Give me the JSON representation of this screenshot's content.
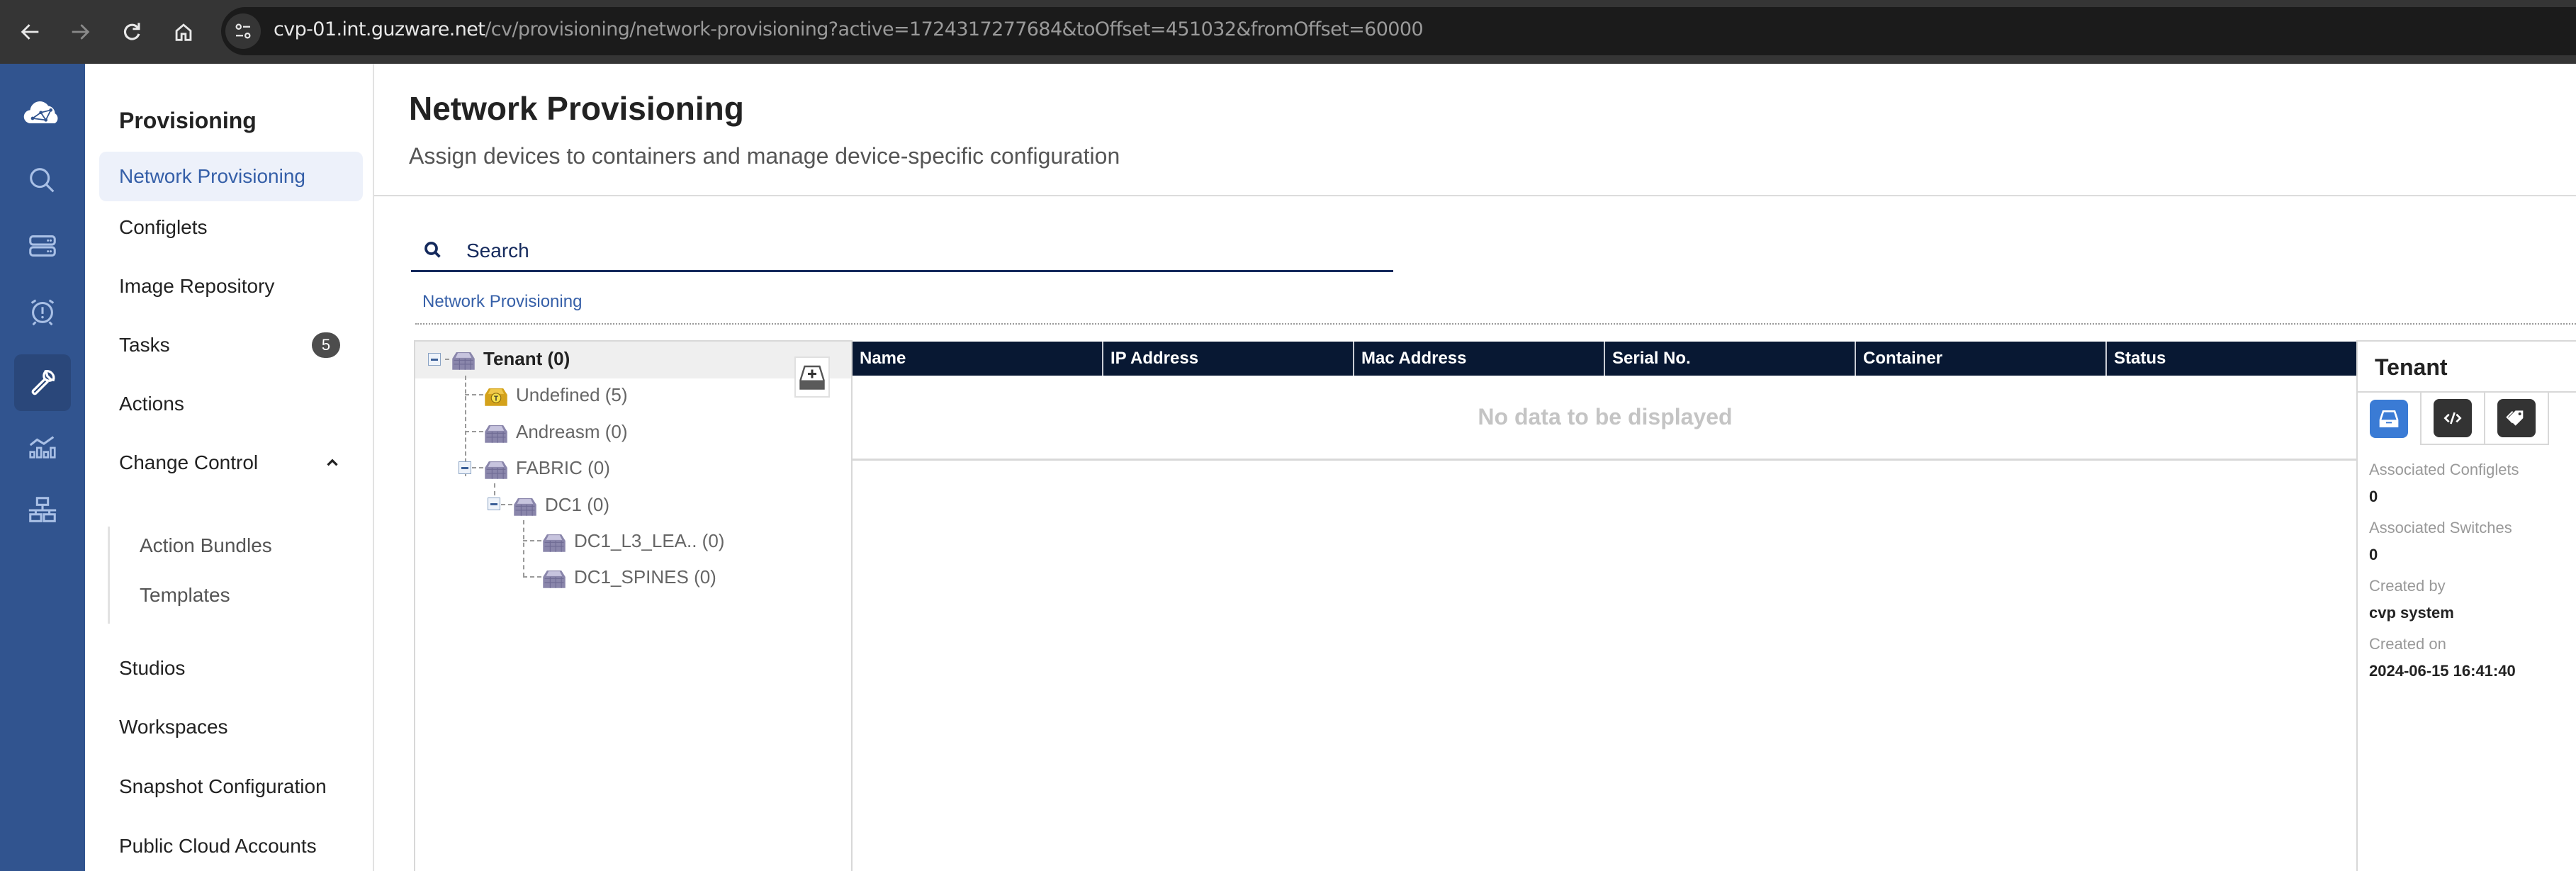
{
  "browser": {
    "url_host": "cvp-01.int.guzware.net",
    "url_path": "/cv/provisioning/network-provisioning?active=1724317277684&toOffset=451032&fromOffset=60000",
    "buttons": [
      "back",
      "forward",
      "reload",
      "home"
    ]
  },
  "rail": {
    "logo": "cloudvision-logo-icon",
    "items": [
      {
        "icon": "search-icon",
        "active": false
      },
      {
        "icon": "devices-icon",
        "active": false
      },
      {
        "icon": "events-alarm-icon",
        "active": false
      },
      {
        "icon": "provisioning-wrench-icon",
        "active": true
      },
      {
        "icon": "dashboards-chart-icon",
        "active": false
      },
      {
        "icon": "topology-icon",
        "active": false
      }
    ]
  },
  "sidebar": {
    "title": "Provisioning",
    "items": [
      {
        "label": "Network Provisioning",
        "active": true
      },
      {
        "label": "Configlets"
      },
      {
        "label": "Image Repository"
      },
      {
        "label": "Tasks",
        "badge": "5"
      },
      {
        "label": "Actions"
      },
      {
        "label": "Change Control",
        "expanded": true
      }
    ],
    "change_control_children": [
      {
        "label": "Action Bundles"
      },
      {
        "label": "Templates"
      }
    ],
    "items_after": [
      {
        "label": "Studios"
      },
      {
        "label": "Workspaces"
      },
      {
        "label": "Snapshot Configuration"
      },
      {
        "label": "Public Cloud Accounts"
      }
    ]
  },
  "header": {
    "title": "Network Provisioning",
    "subtitle": "Assign devices to containers and manage device-specific configuration"
  },
  "search": {
    "placeholder": "Search",
    "value": ""
  },
  "breadcrumb": [
    "Network Provisioning"
  ],
  "tree": {
    "nodes": [
      {
        "label": "Tenant (0)",
        "level": 0,
        "expanded": true,
        "selected": true,
        "type": "container"
      },
      {
        "label": "Undefined (5)",
        "level": 1,
        "type": "undefined-container"
      },
      {
        "label": "Andreasm (0)",
        "level": 1,
        "type": "container"
      },
      {
        "label": "FABRIC (0)",
        "level": 1,
        "expanded": true,
        "type": "container"
      },
      {
        "label": "DC1 (0)",
        "level": 2,
        "expanded": true,
        "type": "container"
      },
      {
        "label": "DC1_L3_LEA.. (0)",
        "level": 3,
        "type": "container"
      },
      {
        "label": "DC1_SPINES (0)",
        "level": 3,
        "type": "container"
      }
    ],
    "add_button": "add-container"
  },
  "table": {
    "columns": [
      "Name",
      "IP Address",
      "Mac Address",
      "Serial No.",
      "Container",
      "Status"
    ],
    "rows": [],
    "empty_text": "No data to be displayed"
  },
  "info_panel": {
    "title": "Tenant",
    "tabs": [
      {
        "icon": "container-info-icon",
        "active": true
      },
      {
        "icon": "code-configlet-icon",
        "active": false
      },
      {
        "icon": "tag-icon",
        "active": false
      }
    ],
    "fields": [
      {
        "label": "Associated Configlets",
        "value": "0"
      },
      {
        "label": "Associated Switches",
        "value": "0"
      },
      {
        "label": "Created by",
        "value": "cvp system"
      },
      {
        "label": "Created on",
        "value": "2024-06-15 16:41:40"
      }
    ]
  },
  "colors": {
    "rail": "#31548f",
    "accent": "#355fa8",
    "table_header": "#081833",
    "search_underline": "#14295c",
    "badge": "#4d4d4d",
    "info_tab_active": "#3a7bd5"
  }
}
